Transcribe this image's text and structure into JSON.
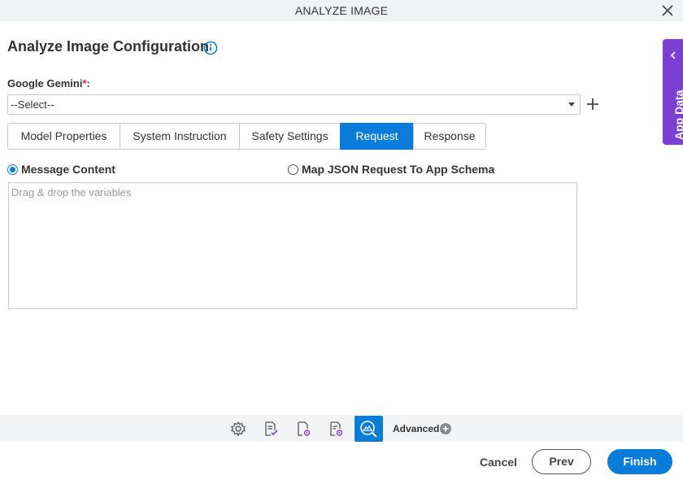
{
  "window": {
    "title": "ANALYZE IMAGE"
  },
  "page": {
    "heading": "Analyze Image Configuration"
  },
  "model_field": {
    "label": "Google Gemini",
    "required_mark": "*",
    "label_suffix": ":",
    "selected_value": "--Select--"
  },
  "tabs": [
    {
      "label": "Model Properties",
      "active": false
    },
    {
      "label": "System Instruction",
      "active": false
    },
    {
      "label": "Safety Settings",
      "active": false
    },
    {
      "label": "Request",
      "active": true
    },
    {
      "label": "Response",
      "active": false
    }
  ],
  "request": {
    "options": [
      {
        "label": "Message Content",
        "checked": true
      },
      {
        "label": "Map JSON Request To App Schema",
        "checked": false
      }
    ],
    "message_placeholder": "Drag & drop the variables"
  },
  "side_panel": {
    "label": "App Data"
  },
  "toolbar": {
    "icons": [
      "gear-icon",
      "document-check-icon",
      "document-settings-icon",
      "document-gear-icon",
      "image-search-icon"
    ],
    "advanced_label": "Advanced"
  },
  "footer": {
    "cancel_label": "Cancel",
    "prev_label": "Prev",
    "finish_label": "Finish"
  },
  "colors": {
    "accent": "#0a7cd9",
    "side_panel": "#7b3fd4",
    "required": "#d9232e"
  }
}
